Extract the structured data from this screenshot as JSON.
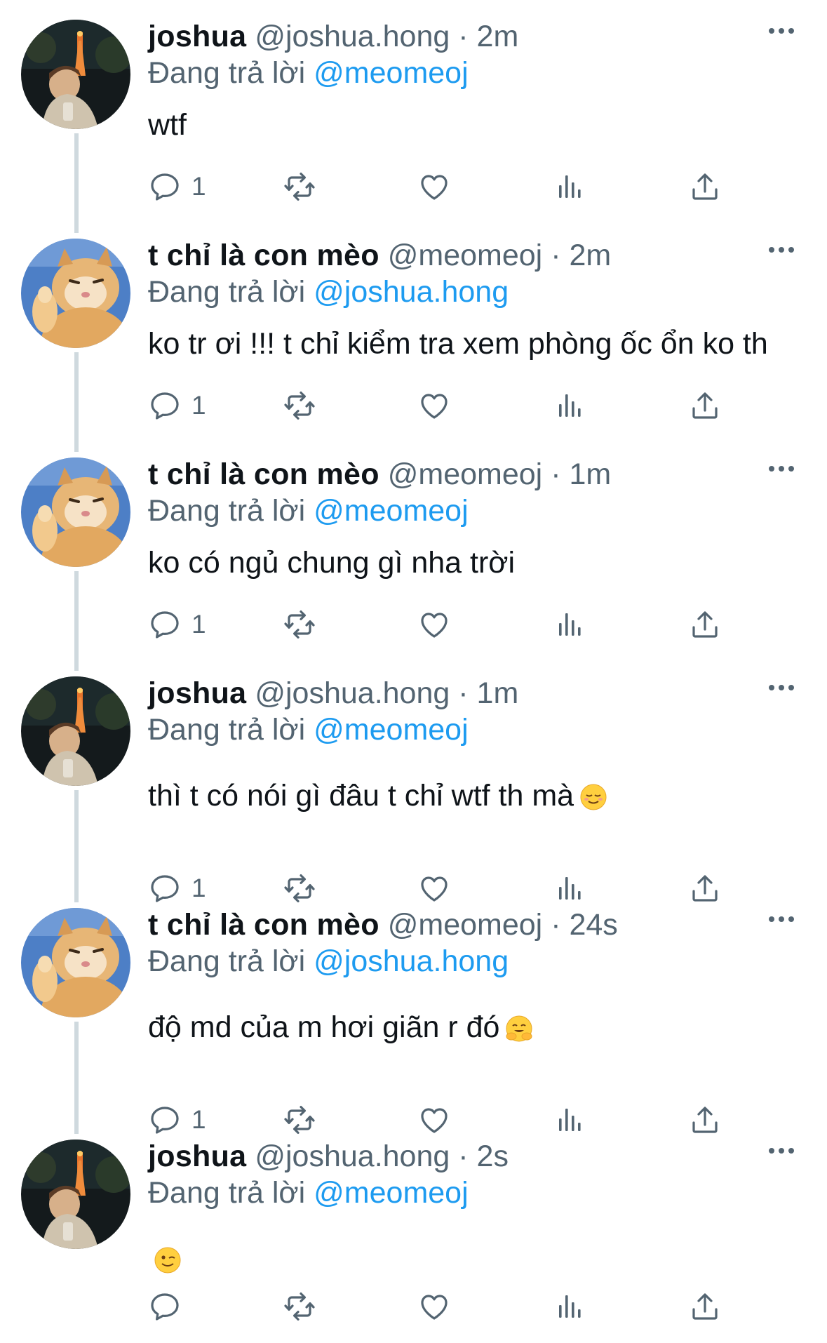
{
  "tweets": [
    {
      "name": "joshua",
      "handle": "@joshua.hong",
      "time": "2m",
      "replying_label": "Đang trả lời",
      "replying_to": "@meomeoj",
      "text": "wtf",
      "emoji": "",
      "avatar": "joshua-avatar",
      "reply_count": "1"
    },
    {
      "name": "t chỉ là con mèo",
      "handle": "@meomeoj",
      "time": "2m",
      "replying_label": "Đang trả lời",
      "replying_to": "@joshua.hong",
      "text": "ko tr ơi !!! t chỉ kiểm tra xem phòng ốc ổn ko th",
      "emoji": "",
      "avatar": "cat-avatar",
      "reply_count": "1"
    },
    {
      "name": "t chỉ là con mèo",
      "handle": "@meomeoj",
      "time": "1m",
      "replying_label": "Đang trả lời",
      "replying_to": "@meomeoj",
      "text": "ko có ngủ chung gì nha trời",
      "emoji": "",
      "avatar": "cat-avatar",
      "reply_count": "1"
    },
    {
      "name": "joshua",
      "handle": "@joshua.hong",
      "time": "1m",
      "replying_label": "Đang trả lời",
      "replying_to": "@meomeoj",
      "text": "thì t có nói gì đâu t chỉ wtf th mà",
      "emoji": "relieved-face-emoji",
      "avatar": "joshua-avatar",
      "reply_count": "1"
    },
    {
      "name": "t chỉ là con mèo",
      "handle": "@meomeoj",
      "time": "24s",
      "replying_label": "Đang trả lời",
      "replying_to": "@joshua.hong",
      "text": "độ md của m hơi giãn r đó",
      "emoji": "hugging-face-emoji",
      "avatar": "cat-avatar",
      "reply_count": "1"
    },
    {
      "name": "joshua",
      "handle": "@joshua.hong",
      "time": "2s",
      "replying_label": "Đang trả lời",
      "replying_to": "@meomeoj",
      "text": "",
      "emoji": "winking-face-emoji",
      "avatar": "joshua-avatar",
      "reply_count": ""
    }
  ],
  "separator": "·",
  "icons": {
    "reply": "reply-icon",
    "retweet": "retweet-icon",
    "like": "like-icon",
    "views": "views-icon",
    "share": "share-icon",
    "more": "more-icon"
  },
  "colors": {
    "name": "#0f1419",
    "meta": "#536471",
    "mention": "#1d9bf0",
    "thread_line": "#cfd9de"
  }
}
